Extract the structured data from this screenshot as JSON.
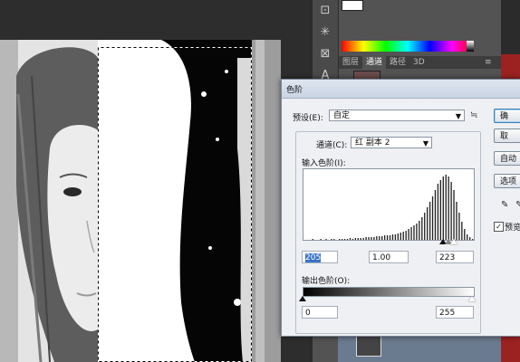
{
  "dialog": {
    "title": "色阶",
    "preset_label": "预设(E):",
    "preset_value": "自定",
    "channel_label": "通道(C):",
    "channel_value": "红 副本 2",
    "input_levels_label": "输入色阶(I):",
    "input_black": "205",
    "input_gamma": "1.00",
    "input_white": "223",
    "output_levels_label": "输出色阶(O):",
    "output_black": "0",
    "output_white": "255",
    "buttons": {
      "ok": "确",
      "cancel": "取",
      "auto": "自动",
      "options": "选项"
    },
    "preview_label": "预览",
    "preview_checked": "✓"
  },
  "panels": {
    "tabs": [
      "图层",
      "通道",
      "路径",
      "3D"
    ],
    "active_tab": "通道"
  },
  "histogram": {
    "levels": [
      0,
      0,
      0,
      1,
      0,
      0,
      1,
      0,
      1,
      0,
      1,
      1,
      0,
      1,
      1,
      1,
      1,
      2,
      1,
      2,
      2,
      2,
      2,
      3,
      3,
      3,
      3,
      4,
      4,
      4,
      5,
      5,
      5,
      6,
      6,
      7,
      8,
      9,
      10,
      12,
      14,
      16,
      18,
      21,
      25,
      30,
      36,
      42,
      48,
      55,
      62,
      66,
      70,
      72,
      70,
      64,
      55,
      42,
      30,
      20,
      12,
      6,
      3,
      1
    ]
  },
  "colors": {
    "dialog_bg": "#eef0f4",
    "accent_selection": "#3a74c9",
    "panel_bg": "#535353"
  }
}
